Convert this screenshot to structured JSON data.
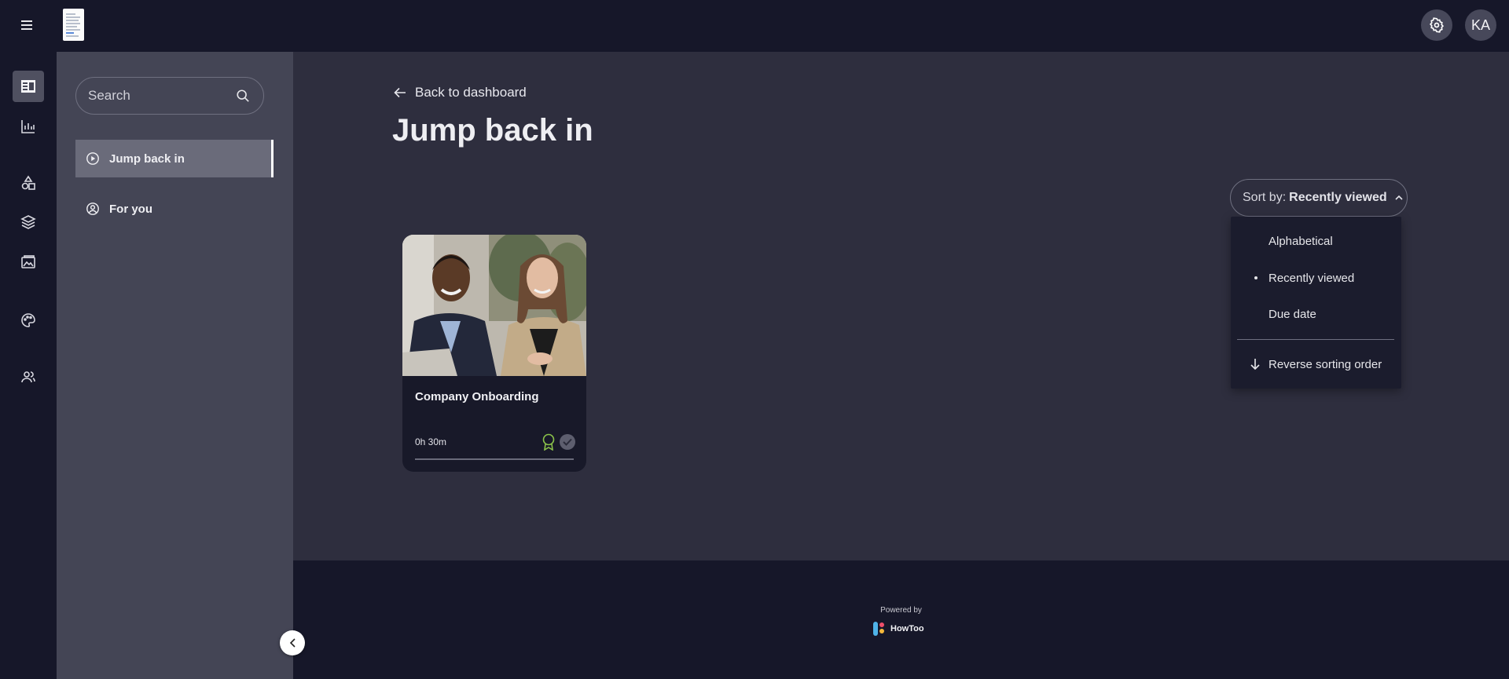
{
  "topbar": {
    "user_initials": "KA"
  },
  "sidebar": {
    "search_placeholder": "Search",
    "nav": [
      {
        "label": "Jump back in",
        "active": true
      },
      {
        "label": "For you",
        "active": false
      }
    ]
  },
  "main": {
    "back_label": "Back to dashboard",
    "title": "Jump back in",
    "sort": {
      "prefix": "Sort by:",
      "selected": "Recently viewed",
      "options": [
        "Alphabetical",
        "Recently viewed",
        "Due date"
      ],
      "reverse_label": "Reverse sorting order"
    },
    "cards": [
      {
        "title": "Company Onboarding",
        "duration": "0h 30m"
      }
    ]
  },
  "footer": {
    "powered_by": "Powered by",
    "brand": "HowToo"
  },
  "colors": {
    "topbar_bg": "#161729",
    "sidebar_bg": "#444555",
    "main_bg": "#2e2e3e",
    "badge_green": "#8bc34a"
  }
}
